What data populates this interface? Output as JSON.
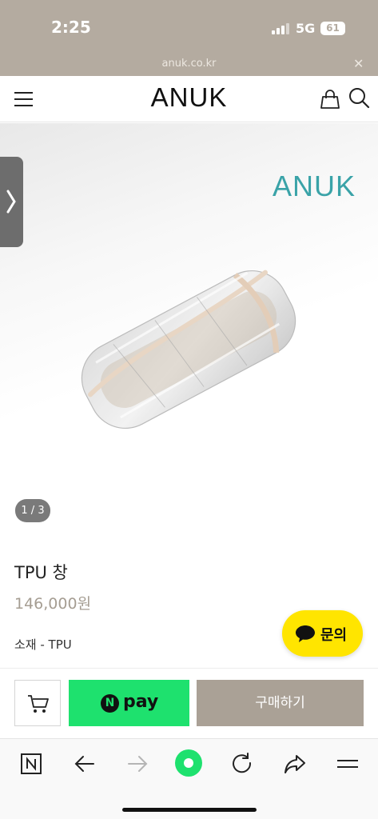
{
  "status": {
    "time": "2:25",
    "network": "5G",
    "battery": "61"
  },
  "browser": {
    "url": "anuk.co.kr",
    "close_icon": "close-icon",
    "accent": "#1ee16e"
  },
  "header": {
    "logo": "ANUK",
    "menu_icon": "hamburger-icon",
    "bag_icon": "shopping-bag-icon",
    "search_icon": "search-icon"
  },
  "gallery": {
    "brand_mark": "ANUK",
    "brand_color": "#3aa3a8",
    "counter": "1 / 3",
    "side_tab_icon": "chevron-right-icon"
  },
  "product": {
    "name": "TPU 창",
    "price": "146,000원",
    "material": "소재 - TPU"
  },
  "inquiry": {
    "label": "문의",
    "color": "#ffe500"
  },
  "purchase": {
    "cart_icon": "cart-icon",
    "npay_logo": "N",
    "npay_label": "pay",
    "buy_label": "구매하기",
    "buy_color": "#aaa196"
  },
  "toolbar": {
    "icons": [
      "naver-n-icon",
      "back-arrow-icon",
      "forward-arrow-icon",
      "green-dot-icon",
      "refresh-icon",
      "share-icon",
      "menu-icon"
    ]
  }
}
